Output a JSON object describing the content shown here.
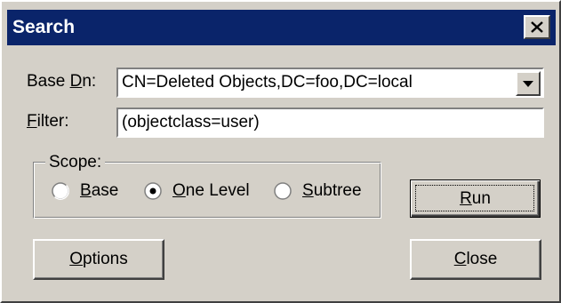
{
  "dialog": {
    "title": "Search"
  },
  "base_dn": {
    "label_pre": "Base ",
    "label_mnemonic": "D",
    "label_post": "n:",
    "value": "CN=Deleted Objects,DC=foo,DC=local"
  },
  "filter": {
    "label_mnemonic": "F",
    "label_post": "ilter:",
    "value": "(objectclass=user)"
  },
  "scope": {
    "label": "Scope:",
    "options": [
      {
        "mnemonic": "B",
        "rest": "ase",
        "selected": false
      },
      {
        "mnemonic": "O",
        "rest": "ne Level",
        "selected": true
      },
      {
        "mnemonic": "S",
        "rest": "ubtree",
        "selected": false
      }
    ]
  },
  "buttons": {
    "run": {
      "mnemonic": "R",
      "rest": "un"
    },
    "options": {
      "mnemonic": "O",
      "rest": "ptions"
    },
    "close": {
      "mnemonic": "C",
      "rest": "lose"
    }
  },
  "icons": {
    "close": "close-icon",
    "dropdown": "chevron-down-icon"
  },
  "colors": {
    "titlebar": "#0a246a",
    "face": "#d4d0c8"
  }
}
